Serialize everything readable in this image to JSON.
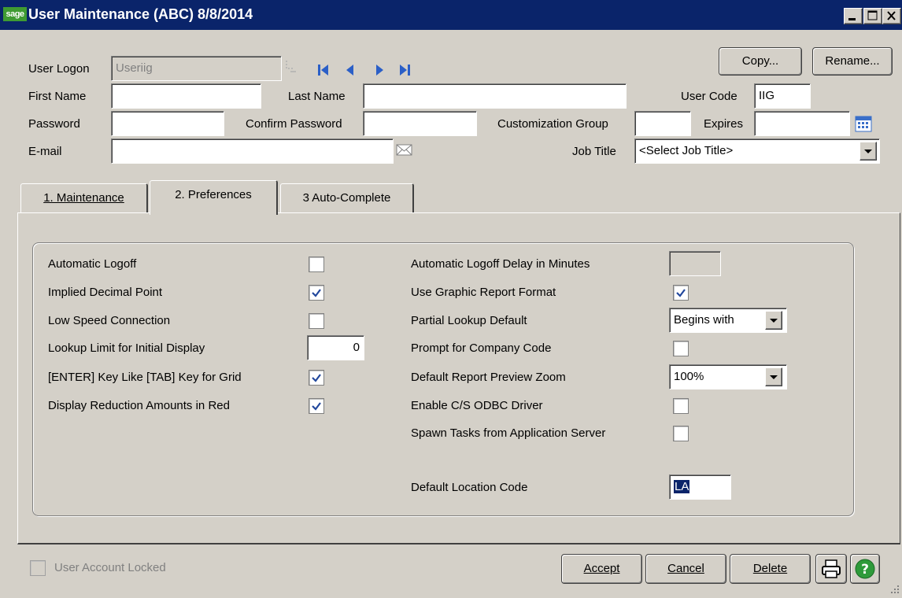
{
  "window": {
    "logo_text": "sage",
    "title": "User Maintenance (ABC) 8/8/2014"
  },
  "header": {
    "user_logon_label": "User Logon",
    "user_logon_value": "Useriig",
    "copy_button": "Copy...",
    "rename_button": "Rename...",
    "first_name_label": "First Name",
    "first_name_value": "",
    "last_name_label": "Last Name",
    "last_name_value": "",
    "user_code_label": "User Code",
    "user_code_value": "IIG",
    "password_label": "Password",
    "password_value": "",
    "confirm_password_label": "Confirm Password",
    "confirm_password_value": "",
    "customization_group_label": "Customization Group",
    "customization_group_value": "",
    "expires_label": "Expires",
    "expires_value": "",
    "email_label": "E-mail",
    "email_value": "",
    "job_title_label": "Job Title",
    "job_title_value": "<Select Job Title>"
  },
  "tabs": [
    {
      "label": "1. Maintenance",
      "active": false
    },
    {
      "label": "2. Preferences",
      "active": true
    },
    {
      "label": "3 Auto-Complete",
      "active": false
    }
  ],
  "preferences": {
    "left": [
      {
        "label": "Automatic Logoff",
        "type": "checkbox",
        "checked": false
      },
      {
        "label": "Implied Decimal Point",
        "type": "checkbox",
        "checked": true
      },
      {
        "label": "Low Speed Connection",
        "type": "checkbox",
        "checked": false
      },
      {
        "label": "Lookup Limit for Initial Display",
        "type": "number",
        "value": "0"
      },
      {
        "label": "[ENTER] Key Like [TAB] Key for Grid",
        "type": "checkbox",
        "checked": true
      },
      {
        "label": "Display Reduction Amounts in Red",
        "type": "checkbox",
        "checked": true
      }
    ],
    "right": [
      {
        "label": "Automatic Logoff Delay in Minutes",
        "type": "text-disabled",
        "value": ""
      },
      {
        "label": "Use Graphic Report Format",
        "type": "checkbox",
        "checked": true
      },
      {
        "label": "Partial Lookup Default",
        "type": "select",
        "value": "Begins with"
      },
      {
        "label": "Prompt for Company Code",
        "type": "checkbox",
        "checked": false
      },
      {
        "label": "Default Report Preview Zoom",
        "type": "select",
        "value": "100%"
      },
      {
        "label": "Enable C/S ODBC Driver",
        "type": "checkbox",
        "checked": false
      },
      {
        "label": "Spawn Tasks from Application Server",
        "type": "checkbox",
        "checked": false
      },
      {
        "label": "Default Location Code",
        "type": "text-selected",
        "value": "LA"
      }
    ]
  },
  "footer": {
    "user_account_locked_label": "User Account Locked",
    "accept_button": "Accept",
    "cancel_button": "Cancel",
    "delete_button": "Delete"
  },
  "colors": {
    "titlebar": "#0a246a",
    "window_bg": "#d4d0c8",
    "check": "#21479c",
    "help_green": "#2e9a3a",
    "selection": "#0a246a"
  },
  "icons": [
    "sage-logo",
    "minimize-icon",
    "maximize-icon",
    "close-icon",
    "lookup-icon",
    "first-record-icon",
    "previous-record-icon",
    "next-record-icon",
    "last-record-icon",
    "calendar-icon",
    "email-icon",
    "dropdown-arrow-icon",
    "print-icon",
    "help-icon"
  ]
}
